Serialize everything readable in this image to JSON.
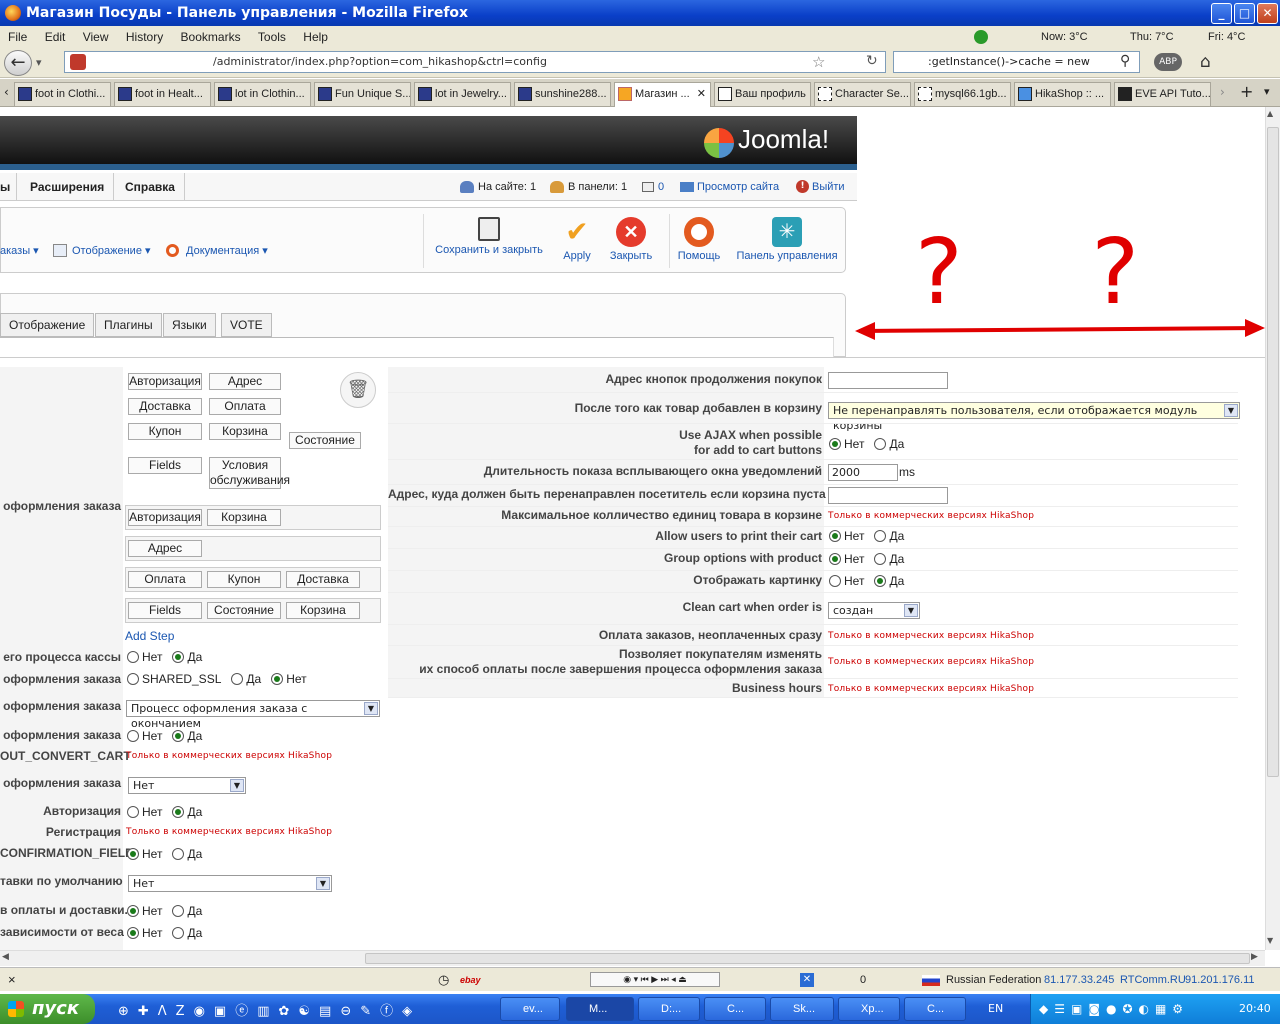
{
  "window": {
    "title": "Магазин Посуды - Панель управления - Mozilla Firefox"
  },
  "menu": [
    "File",
    "Edit",
    "View",
    "History",
    "Bookmarks",
    "Tools",
    "Help"
  ],
  "weather": {
    "now": "Now: 3°C",
    "thu": "Thu: 7°C",
    "fri": "Fri: 4°C"
  },
  "nav": {
    "url": "/administrator/index.php?option=com_hikashop&ctrl=config",
    "search": ":getInstance()->cache = new"
  },
  "tabs": [
    "foot in Clothi...",
    "foot in Healt...",
    "lot in Clothin...",
    "Fun Unique S...",
    "lot in Jewelry...",
    "sunshine288...",
    "Магазин ...",
    "Ваш профиль",
    "Character Se...",
    "mysql66.1gb...",
    "HikaShop :: ...",
    "EVE API Tuto..."
  ],
  "joomla": {
    "logo": "Joomla!",
    "submenu": {
      "left_fragment": "ы",
      "extensions": "Расширения",
      "help": "Справка",
      "onsite": "На сайте: 1",
      "inpanel": "В панели: 1",
      "messages": "0",
      "view_site": "Просмотр сайта",
      "logout": "Выйти"
    },
    "dropdowns": {
      "orders": "аказы ▾",
      "display": "Отображение ▾",
      "docs": "Документация ▾"
    },
    "toolbar": {
      "save_close": "Сохранить и закрыть",
      "apply": "Apply",
      "close": "Закрыть",
      "help": "Помощь",
      "panel": "Панель управления"
    },
    "config_tabs": [
      "Отображение",
      "Плагины",
      "Языки",
      "VOTE"
    ]
  },
  "annotation": {
    "marks": "? ? ?",
    "arrow_color": "#e00000"
  },
  "steps": {
    "palette": [
      "Авторизация",
      "Адрес",
      "Доставка",
      "Оплата",
      "Купон",
      "Корзина",
      "Состояние",
      "Fields",
      "Условия обслуживания"
    ],
    "row1": [
      "Авторизация",
      "Корзина"
    ],
    "row2": [
      "Адрес"
    ],
    "row3": [
      "Оплата",
      "Купон",
      "Доставка"
    ],
    "row4": [
      "Fields",
      "Состояние",
      "Корзина"
    ],
    "add_step": "Add Step",
    "checkout_label": "оформления заказа"
  },
  "left_settings": [
    {
      "label": "его процесса кассы",
      "type": "radio",
      "options": [
        "Нет",
        "Да"
      ],
      "selected": 1
    },
    {
      "label": "оформления заказа",
      "type": "radio",
      "options": [
        "SHARED_SSL",
        "Да",
        "Нет"
      ],
      "selected": 2
    },
    {
      "label": "оформления заказа",
      "type": "select",
      "value": "Процесс оформления заказа с окончанием"
    },
    {
      "label": "оформления заказа",
      "type": "radio",
      "options": [
        "Нет",
        "Да"
      ],
      "selected": 1
    },
    {
      "label": "OUT_CONVERT_CART",
      "type": "comm",
      "value": "Только в коммерческих версиях HikaShop"
    },
    {
      "label": "оформления заказа",
      "type": "select",
      "value": "Нет"
    },
    {
      "label": "Авторизация",
      "type": "radio",
      "options": [
        "Нет",
        "Да"
      ],
      "selected": 1
    },
    {
      "label": "Регистрация",
      "type": "comm",
      "value": "Только в коммерческих версиях HikaShop"
    },
    {
      "label": "CONFIRMATION_FIELD",
      "type": "radio",
      "options": [
        "Нет",
        "Да"
      ],
      "selected": 0
    },
    {
      "label": "тавки по умолчанию",
      "type": "select",
      "value": "Нет"
    },
    {
      "label": "в оплаты и доставки.",
      "type": "radio",
      "options": [
        "Нет",
        "Да"
      ],
      "selected": 0
    },
    {
      "label": "зависимости от веса",
      "type": "radio",
      "options": [
        "Нет",
        "Да"
      ],
      "selected": 0
    }
  ],
  "right_settings": [
    {
      "label": "Адрес кнопок продолжения покупок",
      "type": "input",
      "value": ""
    },
    {
      "label": "После того как товар добавлен в корзину",
      "type": "select",
      "value": "Не перенаправлять пользователя, если отображается модуль корзины"
    },
    {
      "label": "Use AJAX when possible",
      "label2": "for add to cart buttons",
      "type": "radio",
      "options": [
        "Нет",
        "Да"
      ],
      "selected": 0
    },
    {
      "label": "Длительность показа всплывающего окна уведомлений",
      "type": "input",
      "value": "2000",
      "unit": "ms"
    },
    {
      "label": "Адрес, куда должен быть перенаправлен посетитель если корзина пуста",
      "type": "input",
      "value": ""
    },
    {
      "label": "Максимальное колличество единиц товара в корзине",
      "type": "comm",
      "value": "Только в коммерческих версиях HikaShop"
    },
    {
      "label": "Allow users to print their cart",
      "type": "radio",
      "options": [
        "Нет",
        "Да"
      ],
      "selected": 0
    },
    {
      "label": "Group options with product",
      "type": "radio",
      "options": [
        "Нет",
        "Да"
      ],
      "selected": 0
    },
    {
      "label": "Отображать картинку",
      "type": "radio",
      "options": [
        "Нет",
        "Да"
      ],
      "selected": 1
    },
    {
      "label": "Clean cart when order is",
      "type": "select",
      "value": "создан"
    },
    {
      "label": "Оплата заказов, неоплаченных сразу",
      "type": "comm",
      "value": "Только в коммерческих версиях HikaShop"
    },
    {
      "label": "Позволяет покупателям изменять",
      "label2": "их способ оплаты после завершения процесса оформления заказа",
      "type": "comm",
      "value": "Только в коммерческих версиях HikaShop"
    },
    {
      "label": "Business hours",
      "type": "comm",
      "value": "Только в коммерческих версиях HikaShop"
    }
  ],
  "status": {
    "close": "×",
    "ebay": "ebay",
    "count": "0",
    "country": "Russian Federation",
    "ip1": "81.177.33.245",
    "isp": "RTComm.RU",
    "ip2": "91.201.176.11"
  },
  "taskbar": {
    "start": "пуск",
    "tasks": [
      "ev...",
      "М...",
      "D:...",
      "C...",
      "Sk...",
      "Хр...",
      "C..."
    ],
    "lang": "EN",
    "time": "20:40"
  }
}
